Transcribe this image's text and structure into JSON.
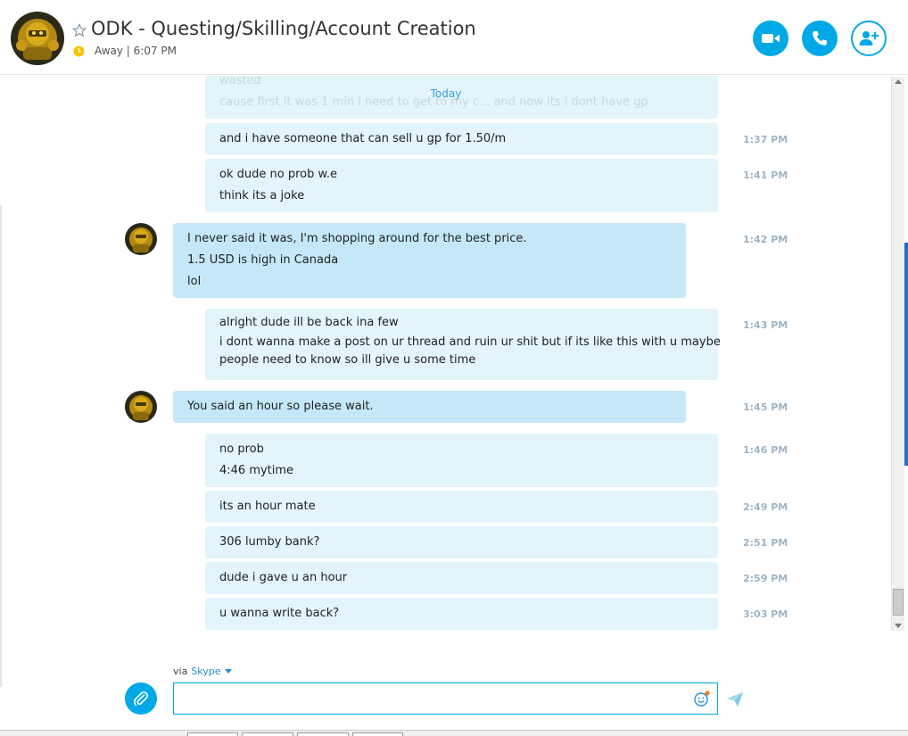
{
  "header": {
    "title": "ODK - Questing/Skilling/Account Creation",
    "status": "Away | 6:07 PM",
    "status_color": "#f5c400",
    "accent": "#00a9e6"
  },
  "chat": {
    "today_label": "Today",
    "faded_lines": [
      "wasted",
      "cause first it was 1 min i need to get to my c... and now its i dont have gp"
    ],
    "messages": [
      {
        "sender": "other",
        "lines": [
          "and i have someone that can sell u gp for 1.50/m"
        ],
        "time": "1:37 PM"
      },
      {
        "sender": "other",
        "lines": [
          "ok dude no prob w.e",
          "think its a joke"
        ],
        "time": "1:41 PM"
      },
      {
        "sender": "me",
        "lines": [
          "I never said it was, I'm shopping around for the best price.",
          "1.5 USD is high in Canada",
          "lol"
        ],
        "time": "1:42 PM"
      },
      {
        "sender": "other",
        "lines": [
          "alright dude ill be back ina  few",
          "i dont wanna make a post on ur thread and ruin ur shit but if its like this with u maybe",
          "people need to know so ill give u some time"
        ],
        "time": "1:43 PM"
      },
      {
        "sender": "me",
        "lines": [
          "You said an hour so please wait."
        ],
        "time": "1:45 PM"
      },
      {
        "sender": "other",
        "lines": [
          "no prob",
          "4:46 mytime"
        ],
        "time": "1:46 PM"
      },
      {
        "sender": "other",
        "lines": [
          "its an hour mate"
        ],
        "time": "2:49 PM"
      },
      {
        "sender": "other",
        "lines": [
          "306 lumby bank?"
        ],
        "time": "2:51 PM"
      },
      {
        "sender": "other",
        "lines": [
          "dude i gave u an hour"
        ],
        "time": "2:59 PM"
      },
      {
        "sender": "other",
        "lines": [
          "u wanna write back?"
        ],
        "time": "3:03 PM"
      }
    ]
  },
  "composer": {
    "via_label": "via",
    "via_link": "Skype",
    "input_value": "",
    "input_placeholder": ""
  }
}
